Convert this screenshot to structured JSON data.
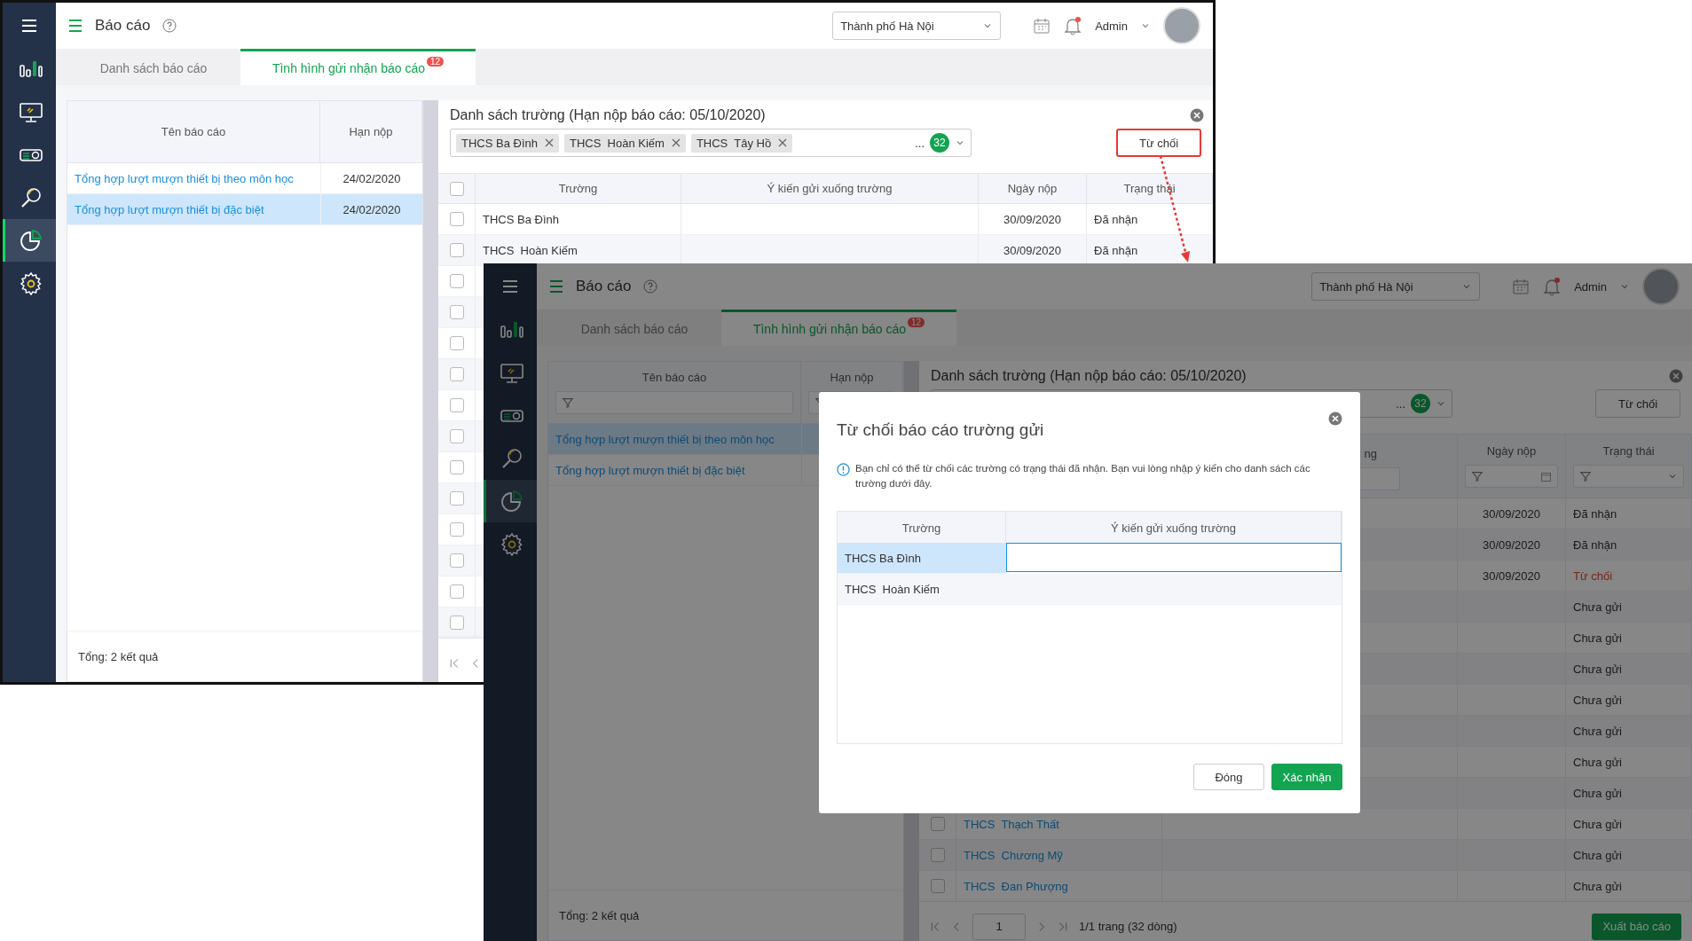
{
  "screens": [
    {
      "header": {
        "title": "Báo cáo",
        "region": "Thành phố Hà Nội",
        "user": "Admin"
      },
      "nav": [
        {
          "kind": "chart",
          "selected": false
        },
        {
          "kind": "monitor",
          "selected": false
        },
        {
          "kind": "projector",
          "selected": false
        },
        {
          "kind": "search",
          "selected": false
        },
        {
          "kind": "pie",
          "selected": true
        },
        {
          "kind": "settings",
          "selected": false
        }
      ],
      "tabs": [
        {
          "label": "Danh sách báo cáo",
          "selected": false
        },
        {
          "label": "Tình hình gửi nhận báo cáo",
          "badge": "12",
          "selected": true
        }
      ],
      "reports": {
        "columns": [
          "Tên báo cáo",
          "Hạn nộp"
        ],
        "rows": [
          {
            "name": "Tổng hợp lượt mượn thiết bị theo môn học",
            "deadline": "24/02/2020",
            "selected": false
          },
          {
            "name": "Tổng hợp lượt mượn thiết bị đặc biệt",
            "deadline": "24/02/2020",
            "selected": true
          }
        ],
        "total": "Tổng: 2 kết quả"
      },
      "schools": {
        "title": "Danh sách trường (Hạn nộp báo cáo: 05/10/2020)",
        "chips": [
          "THCS Ba Đình",
          "THCS  Hoàn Kiếm",
          "THCS  Tây Hồ"
        ],
        "more": "...",
        "count": "32",
        "reject_button": "Từ chối",
        "reject_highlighted": true,
        "select_all": false,
        "columns": [
          {
            "label": "Trường"
          },
          {
            "label": "Ý kiến gửi xuống trường"
          },
          {
            "label": "Ngày nộp"
          },
          {
            "label": "Trạng thái"
          }
        ],
        "rows": [
          {
            "checked": false,
            "school": "THCS Ba Đình",
            "date": "30/09/2020",
            "status": "Đã nhận",
            "kind": "received"
          },
          {
            "checked": false,
            "school": "THCS  Hoàn Kiếm",
            "date": "30/09/2020",
            "status": "Đã nhận",
            "kind": "received"
          },
          {
            "checked": false
          },
          {
            "checked": false
          },
          {
            "checked": false
          },
          {
            "checked": false
          },
          {
            "checked": false
          },
          {
            "checked": false
          },
          {
            "checked": false
          },
          {
            "checked": false
          },
          {
            "checked": false
          },
          {
            "checked": false
          },
          {
            "checked": false
          },
          {
            "checked": false
          }
        ]
      }
    },
    {
      "dimmed": true,
      "header": {
        "title": "Báo cáo",
        "region": "Thành phố Hà Nội",
        "user": "Admin"
      },
      "nav": [
        {
          "kind": "chart",
          "selected": false
        },
        {
          "kind": "monitor",
          "selected": false
        },
        {
          "kind": "projector",
          "selected": false
        },
        {
          "kind": "search",
          "selected": false
        },
        {
          "kind": "pie",
          "selected": true
        },
        {
          "kind": "settings",
          "selected": false
        }
      ],
      "tabs": [
        {
          "label": "Danh sách báo cáo",
          "selected": false
        },
        {
          "label": "Tình hình gửi nhận báo cáo",
          "badge": "12",
          "selected": true
        }
      ],
      "reports": {
        "columns": [
          "Tên báo cáo",
          "Hạn nộp"
        ],
        "filter_row": true,
        "rows": [
          {
            "name": "Tổng hợp lượt mượn thiết bị theo môn học",
            "selected": true
          },
          {
            "name": "Tổng hợp lượt mượn thiết bị đặc biệt",
            "selected": false
          }
        ],
        "total": "Tổng: 2 kết quả"
      },
      "schools": {
        "title": "Danh sách trường (Hạn nộp báo cáo: 05/10/2020)",
        "more": "...",
        "count": "32",
        "reject_button": "Từ chối",
        "reject_highlighted": false,
        "filter_row": true,
        "columns": [
          {},
          {
            "label": "ng"
          },
          {
            "label": "Ngày nộp"
          },
          {
            "label": "Trạng thái"
          }
        ],
        "rows": [
          {
            "date": "30/09/2020",
            "status": "Đã nhận",
            "kind": "received"
          },
          {
            "date": "30/09/2020",
            "status": "Đã nhận",
            "kind": "received"
          },
          {
            "date": "30/09/2020",
            "status": "Từ chối",
            "kind": "rejected"
          },
          {
            "status": "Chưa gửi",
            "kind": "pending"
          },
          {
            "status": "Chưa gửi",
            "kind": "pending"
          },
          {
            "status": "Chưa gửi",
            "kind": "pending"
          },
          {
            "status": "Chưa gửi",
            "kind": "pending"
          },
          {
            "status": "Chưa gửi",
            "kind": "pending"
          },
          {
            "status": "Chưa gửi",
            "kind": "pending"
          },
          {
            "status": "Chưa gửi",
            "kind": "pending"
          },
          {
            "checked": false,
            "school": "THCS  Thạch Thất",
            "status": "Chưa gửi",
            "kind": "pending"
          },
          {
            "checked": false,
            "school": "THCS  Chương Mỹ",
            "status": "Chưa gửi",
            "kind": "pending"
          },
          {
            "checked": false,
            "school": "THCS  Đan Phượng",
            "status": "Chưa gửi",
            "kind": "pending"
          }
        ],
        "pagination": {
          "page": "1",
          "info": "1/1 trang (32 dòng)",
          "export_button": "Xuất báo cáo"
        }
      },
      "dialog": {
        "title": "Từ chối báo cáo trường gửi",
        "info": "Bạn chỉ có thể từ chối các trường có trạng thái đã nhận. Bạn vui lòng nhập ý kiến cho danh sách các trường dưới đây.",
        "columns": [
          "Trường",
          "Ý kiến gửi xuống trường"
        ],
        "rows": [
          {
            "school": "THCS Ba Đình",
            "selected": true
          },
          {
            "school": "THCS  Hoàn Kiếm",
            "selected": false
          }
        ],
        "buttons": [
          "Đóng",
          "Xác nhận"
        ]
      }
    }
  ]
}
